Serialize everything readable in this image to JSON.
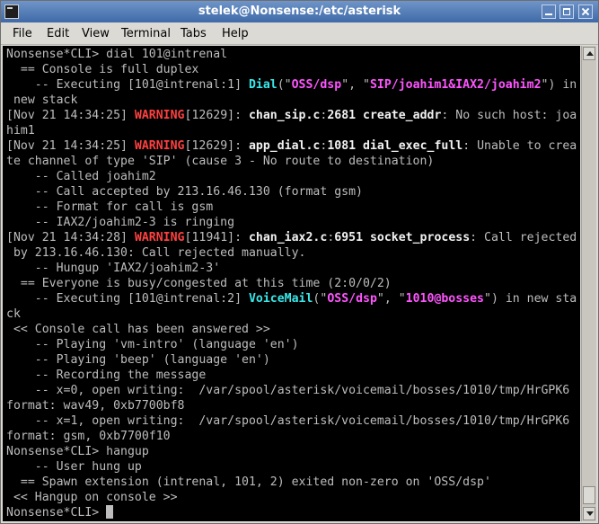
{
  "window": {
    "title": "stelek@Nonsense:/etc/asterisk"
  },
  "menu": [
    "File",
    "Edit",
    "View",
    "Terminal",
    "Tabs",
    "Help"
  ],
  "colors": {
    "terminal_bg": "#000000",
    "text": "#bdbdbd",
    "bold": "#f2f2f2",
    "warning": "#ff4040",
    "cyan": "#39e8ea",
    "magenta": "#ff55ff",
    "titlebar": "#4f78b3"
  },
  "terminal": {
    "lines": [
      [
        {
          "t": "Nonsense*CLI> dial 101@intrenal"
        }
      ],
      [
        {
          "t": "  == Console is full duplex"
        }
      ],
      [
        {
          "t": "    -- Executing [101@intrenal:1] "
        },
        {
          "t": "Dial",
          "c": "cyan"
        },
        {
          "t": "(\""
        },
        {
          "t": "OSS/dsp",
          "c": "magenta"
        },
        {
          "t": "\", \""
        },
        {
          "t": "SIP/joahim1&IAX2/joahim2",
          "c": "magenta"
        },
        {
          "t": "\") in"
        }
      ],
      [
        {
          "t": " new stack"
        }
      ],
      [
        {
          "t": "[Nov 21 14:34:25] "
        },
        {
          "t": "WARNING",
          "c": "red"
        },
        {
          "t": "[12629]: "
        },
        {
          "t": "chan_sip.c",
          "c": "white"
        },
        {
          "t": ":"
        },
        {
          "t": "2681",
          "c": "white"
        },
        {
          "t": " "
        },
        {
          "t": "create_addr",
          "c": "white"
        },
        {
          "t": ": No such host: joa"
        }
      ],
      [
        {
          "t": "him1"
        }
      ],
      [
        {
          "t": "[Nov 21 14:34:25] "
        },
        {
          "t": "WARNING",
          "c": "red"
        },
        {
          "t": "[12629]: "
        },
        {
          "t": "app_dial.c",
          "c": "white"
        },
        {
          "t": ":"
        },
        {
          "t": "1081",
          "c": "white"
        },
        {
          "t": " "
        },
        {
          "t": "dial_exec_full",
          "c": "white"
        },
        {
          "t": ": Unable to crea"
        }
      ],
      [
        {
          "t": "te channel of type 'SIP' (cause 3 - No route to destination)"
        }
      ],
      [
        {
          "t": "    -- Called joahim2"
        }
      ],
      [
        {
          "t": "    -- Call accepted by 213.16.46.130 (format gsm)"
        }
      ],
      [
        {
          "t": "    -- Format for call is gsm"
        }
      ],
      [
        {
          "t": "    -- IAX2/joahim2-3 is ringing"
        }
      ],
      [
        {
          "t": "[Nov 21 14:34:28] "
        },
        {
          "t": "WARNING",
          "c": "red"
        },
        {
          "t": "[11941]: "
        },
        {
          "t": "chan_iax2.c",
          "c": "white"
        },
        {
          "t": ":"
        },
        {
          "t": "6951",
          "c": "white"
        },
        {
          "t": " "
        },
        {
          "t": "socket_process",
          "c": "white"
        },
        {
          "t": ": Call rejected"
        }
      ],
      [
        {
          "t": " by 213.16.46.130: Call rejected manually."
        }
      ],
      [
        {
          "t": "    -- Hungup 'IAX2/joahim2-3'"
        }
      ],
      [
        {
          "t": "  == Everyone is busy/congested at this time (2:0/0/2)"
        }
      ],
      [
        {
          "t": "    -- Executing [101@intrenal:2] "
        },
        {
          "t": "VoiceMail",
          "c": "cyan"
        },
        {
          "t": "(\""
        },
        {
          "t": "OSS/dsp",
          "c": "magenta"
        },
        {
          "t": "\", \""
        },
        {
          "t": "1010@bosses",
          "c": "magenta"
        },
        {
          "t": "\") in new sta"
        }
      ],
      [
        {
          "t": "ck"
        }
      ],
      [
        {
          "t": " << Console call has been answered >>"
        }
      ],
      [
        {
          "t": "    -- Playing 'vm-intro' (language 'en')"
        }
      ],
      [
        {
          "t": "    -- Playing 'beep' (language 'en')"
        }
      ],
      [
        {
          "t": "    -- Recording the message"
        }
      ],
      [
        {
          "t": "    -- x=0, open writing:  /var/spool/asterisk/voicemail/bosses/1010/tmp/HrGPK6"
        }
      ],
      [
        {
          "t": "format: wav49, 0xb7700bf8"
        }
      ],
      [
        {
          "t": "    -- x=1, open writing:  /var/spool/asterisk/voicemail/bosses/1010/tmp/HrGPK6"
        }
      ],
      [
        {
          "t": "format: gsm, 0xb7700f10"
        }
      ],
      [
        {
          "t": "Nonsense*CLI> hangup"
        }
      ],
      [
        {
          "t": "    -- User hung up"
        }
      ],
      [
        {
          "t": "  == Spawn extension (intrenal, 101, 2) exited non-zero on 'OSS/dsp'"
        }
      ],
      [
        {
          "t": " << Hangup on console >>"
        }
      ],
      [
        {
          "t": "Nonsense*CLI> "
        }
      ]
    ]
  }
}
